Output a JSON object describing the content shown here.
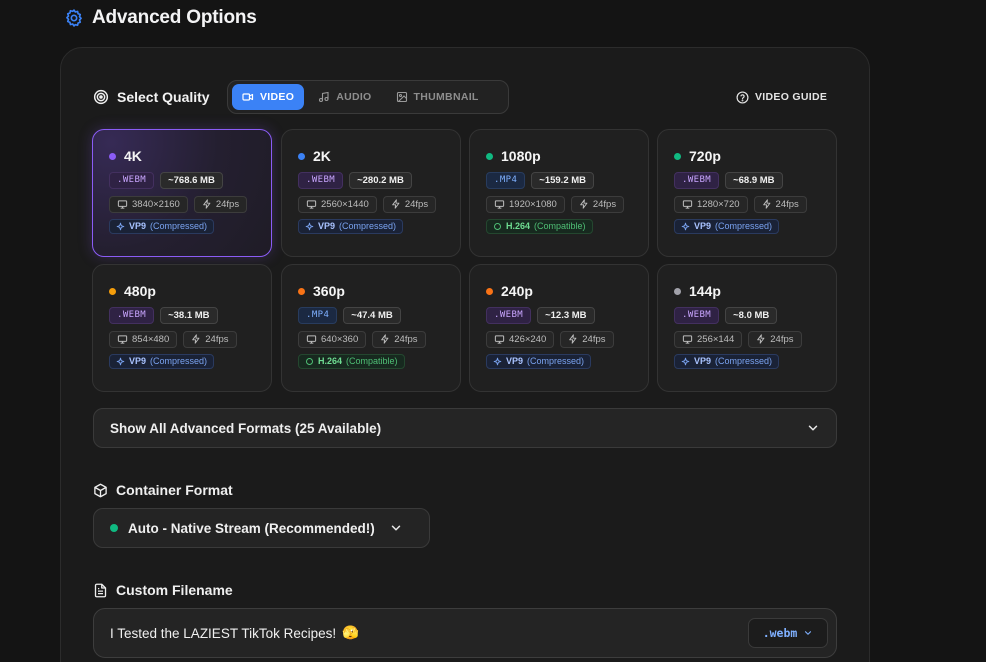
{
  "header": {
    "title": "Advanced Options"
  },
  "quality": {
    "title": "Select Quality",
    "tabs": [
      {
        "label": "VIDEO",
        "active": true
      },
      {
        "label": "AUDIO",
        "active": false
      },
      {
        "label": "THUMBNAIL",
        "active": false
      }
    ],
    "guide_label": "VIDEO GUIDE",
    "cards": [
      {
        "label": "4K",
        "dot_color": "#8b5cf6",
        "format": ".WEBM",
        "format_kind": "webm",
        "size": "~768.6 MB",
        "resolution": "3840×2160",
        "fps": "24fps",
        "codec": "VP9",
        "codec_note": "(Compressed)",
        "codec_kind": "vp9",
        "selected": true
      },
      {
        "label": "2K",
        "dot_color": "#3b82f6",
        "format": ".WEBM",
        "format_kind": "webm",
        "size": "~280.2 MB",
        "resolution": "2560×1440",
        "fps": "24fps",
        "codec": "VP9",
        "codec_note": "(Compressed)",
        "codec_kind": "vp9",
        "selected": false
      },
      {
        "label": "1080p",
        "dot_color": "#10b981",
        "format": ".MP4",
        "format_kind": "mp4",
        "size": "~159.2 MB",
        "resolution": "1920×1080",
        "fps": "24fps",
        "codec": "H.264",
        "codec_note": "(Compatible)",
        "codec_kind": "h264",
        "selected": false
      },
      {
        "label": "720p",
        "dot_color": "#10b981",
        "format": ".WEBM",
        "format_kind": "webm",
        "size": "~68.9 MB",
        "resolution": "1280×720",
        "fps": "24fps",
        "codec": "VP9",
        "codec_note": "(Compressed)",
        "codec_kind": "vp9",
        "selected": false
      },
      {
        "label": "480p",
        "dot_color": "#f59e0b",
        "format": ".WEBM",
        "format_kind": "webm",
        "size": "~38.1 MB",
        "resolution": "854×480",
        "fps": "24fps",
        "codec": "VP9",
        "codec_note": "(Compressed)",
        "codec_kind": "vp9",
        "selected": false
      },
      {
        "label": "360p",
        "dot_color": "#f97316",
        "format": ".MP4",
        "format_kind": "mp4",
        "size": "~47.4 MB",
        "resolution": "640×360",
        "fps": "24fps",
        "codec": "H.264",
        "codec_note": "(Compatible)",
        "codec_kind": "h264",
        "selected": false
      },
      {
        "label": "240p",
        "dot_color": "#f97316",
        "format": ".WEBM",
        "format_kind": "webm",
        "size": "~12.3 MB",
        "resolution": "426×240",
        "fps": "24fps",
        "codec": "VP9",
        "codec_note": "(Compressed)",
        "codec_kind": "vp9",
        "selected": false
      },
      {
        "label": "144p",
        "dot_color": "#a1a1aa",
        "format": ".WEBM",
        "format_kind": "webm",
        "size": "~8.0 MB",
        "resolution": "256×144",
        "fps": "24fps",
        "codec": "VP9",
        "codec_note": "(Compressed)",
        "codec_kind": "vp9",
        "selected": false
      }
    ]
  },
  "advanced_formats": {
    "label": "Show All Advanced Formats (25 Available)"
  },
  "container": {
    "title": "Container Format",
    "selected": "Auto - Native Stream (Recommended!)"
  },
  "filename": {
    "title": "Custom Filename",
    "value": "I Tested the LAZIEST TikTok Recipes!",
    "emoji": "🫣",
    "extension": ".webm"
  },
  "colors": {
    "accent": "#3b82f6",
    "selected_border": "#8b5cf6",
    "background": "#141414",
    "panel": "#1b1b1b"
  }
}
